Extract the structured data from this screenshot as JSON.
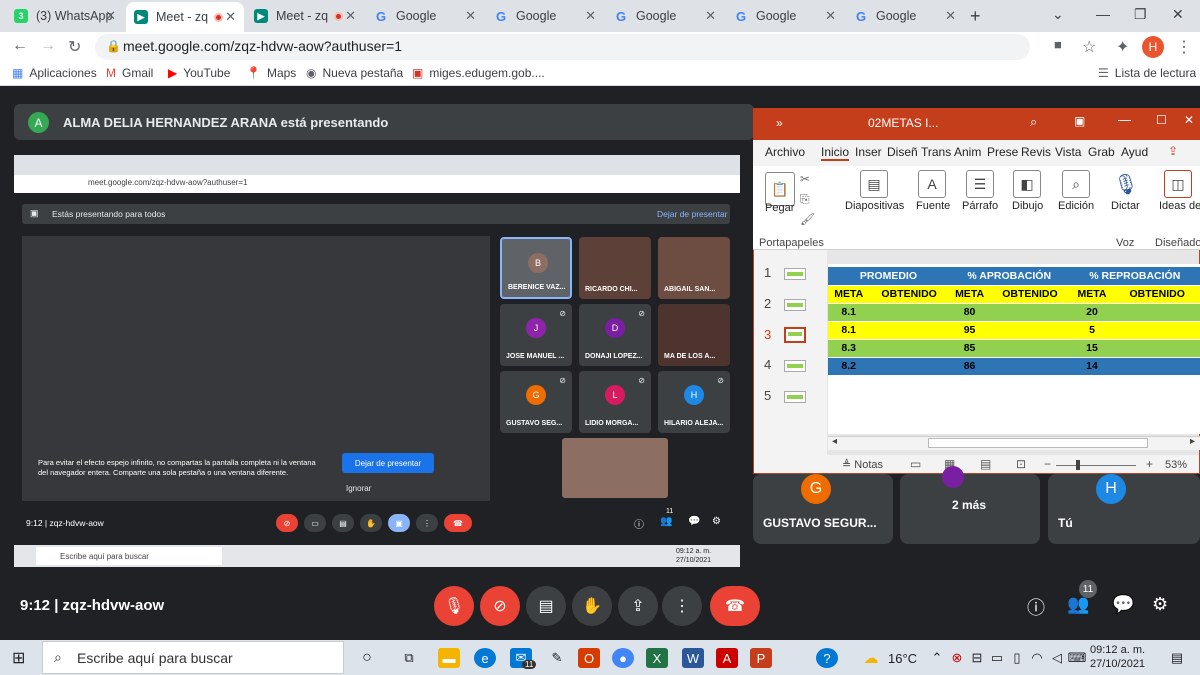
{
  "tabs": [
    {
      "label": "(3) WhatsApp",
      "icon": "whatsapp-icon",
      "badge": "3"
    },
    {
      "label": "Meet - zq",
      "icon": "meet-icon"
    },
    {
      "label": "Meet - zq",
      "icon": "meet-icon"
    },
    {
      "label": "Google",
      "icon": "google-icon"
    },
    {
      "label": "Google",
      "icon": "google-icon"
    },
    {
      "label": "Google",
      "icon": "google-icon"
    },
    {
      "label": "Google",
      "icon": "google-icon"
    },
    {
      "label": "Google",
      "icon": "google-icon"
    }
  ],
  "address": {
    "url": "meet.google.com/zqz-hdvw-aow?authuser=1",
    "profile_initial": "H"
  },
  "bookmarks": [
    {
      "label": "Aplicaciones"
    },
    {
      "label": "Gmail"
    },
    {
      "label": "YouTube"
    },
    {
      "label": "Maps"
    },
    {
      "label": "Nueva pestaña"
    },
    {
      "label": "miges.edugem.gob...."
    }
  ],
  "reading_list": "Lista de lectura",
  "presenter": {
    "initial": "A",
    "text": "ALMA DELIA HERNANDEZ ARANA está presentando"
  },
  "nested": {
    "url": "meet.google.com/zqz-hdvw-aow?authuser=1",
    "presenting_text": "Estás presentando para todos",
    "stop_link": "Dejar de presentar",
    "mirror_text": "Para evitar el efecto espejo infinito, no compartas la pantalla completa ni la ventana del navegador entera. Comparte una sola pestaña o una ventana diferente.",
    "stop_button": "Dejar de presentar",
    "ignore": "Ignorar",
    "time_code": "9:12  |  zqz-hdvw-aow",
    "participants": [
      {
        "name": "BERENICE VAZ...",
        "initial": "B",
        "color": "#8d6e63"
      },
      {
        "name": "RICARDO CHI...",
        "initial": "",
        "color": "#5d4037"
      },
      {
        "name": "ABIGAIL SAN...",
        "initial": "",
        "color": "#6d4c41"
      },
      {
        "name": "JOSE MANUEL ...",
        "initial": "J",
        "color": "#8e24aa"
      },
      {
        "name": "DONAJI LOPEZ...",
        "initial": "D",
        "color": "#7b1fa2"
      },
      {
        "name": "MA DE LOS A...",
        "initial": "",
        "color": "#4e342e"
      },
      {
        "name": "GUSTAVO SEG...",
        "initial": "G",
        "color": "#ef6c00"
      },
      {
        "name": "LIDIO MORGA...",
        "initial": "L",
        "color": "#d81b60"
      },
      {
        "name": "HILARIO ALEJA...",
        "initial": "H",
        "color": "#1e88e5"
      }
    ],
    "taskbar_search": "Escribe aquí para buscar",
    "clock_time": "09:12 a. m.",
    "clock_date": "27/10/2021",
    "people_badge": "11"
  },
  "ppt": {
    "title": "02METAS I...",
    "menu": [
      "Archivo",
      "Inicio",
      "Inser",
      "Diseñ",
      "Trans",
      "Anim",
      "Prese",
      "Revis",
      "Vista",
      "Grab",
      "Ayud"
    ],
    "ribbon": [
      {
        "label": "Pegar",
        "sub": "Portapapeles"
      },
      {
        "label": "Diapositivas"
      },
      {
        "label": "Fuente"
      },
      {
        "label": "Párrafo"
      },
      {
        "label": "Dibujo"
      },
      {
        "label": "Edición"
      },
      {
        "label": "Dictar",
        "sub": "Voz"
      },
      {
        "label": "Ideas de diseño",
        "sub": "Diseñador"
      }
    ],
    "slide_numbers": [
      "1",
      "2",
      "3",
      "4",
      "5"
    ],
    "table": {
      "head1": [
        "PROMEDIO",
        "% APROBACIÓN",
        "% REPROBACIÓN"
      ],
      "head2": [
        "META",
        "OBTENIDO",
        "META",
        "OBTENIDO",
        "META",
        "OBTENIDO"
      ],
      "rows": [
        {
          "meta": "8.1",
          "aprob": "80",
          "reprob": "20",
          "bg": "#92d050"
        },
        {
          "meta": "8.1",
          "aprob": "95",
          "reprob": "5",
          "bg": "#ffff00"
        },
        {
          "meta": "8.3",
          "aprob": "85",
          "reprob": "15",
          "bg": "#92d050"
        },
        {
          "meta": "8.2",
          "aprob": "86",
          "reprob": "14",
          "bg": "#2e75b6"
        }
      ]
    },
    "notes": "Notas",
    "zoom": "53%"
  },
  "tiles": [
    {
      "name": "GUSTAVO SEGUR...",
      "initial": "G",
      "color": "#ef6c00"
    },
    {
      "name": "2 más",
      "initial": "",
      "color": "#7b1fa2"
    },
    {
      "name": "Tú",
      "initial": "H",
      "color": "#1e88e5"
    }
  ],
  "meetbar": {
    "time_code": "9:12  |  zqz-hdvw-aow",
    "people_count": "11"
  },
  "taskbar": {
    "search": "Escribe aquí para buscar",
    "temp": "16°C",
    "time": "09:12 a. m.",
    "date": "27/10/2021",
    "mail_badge": "11"
  }
}
